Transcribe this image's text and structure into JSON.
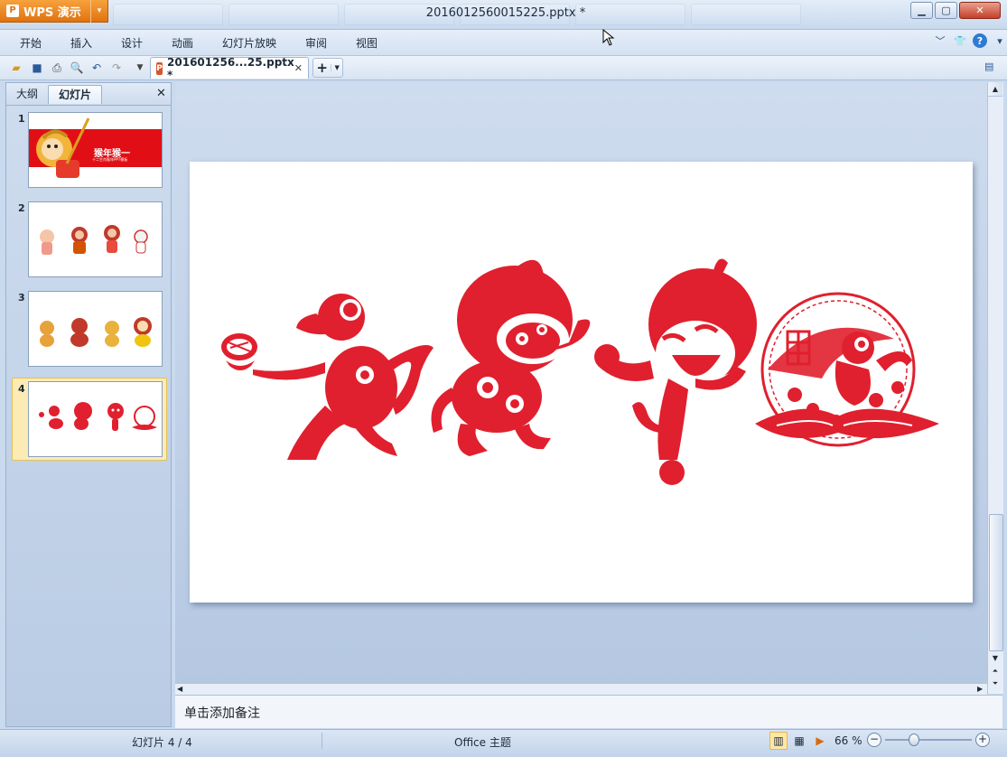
{
  "app": {
    "name": "WPS 演示",
    "document_title": "2016012560015225.pptx *"
  },
  "menu": [
    "开始",
    "插入",
    "设计",
    "动画",
    "幻灯片放映",
    "审阅",
    "视图"
  ],
  "toolbar": {
    "doc_tab_label": "201601256...25.pptx *"
  },
  "left_pane": {
    "tabs": [
      "大纲",
      "幻灯片"
    ],
    "slides": [
      {
        "number": "1",
        "title_text": "猴年猴一",
        "subtitle_text": "十二生肖猴年PPT模板"
      },
      {
        "number": "2"
      },
      {
        "number": "3"
      },
      {
        "number": "4",
        "selected": true
      }
    ]
  },
  "notes": {
    "placeholder": "单击添加备注"
  },
  "status": {
    "slide_indicator": "幻灯片 4 / 4",
    "theme": "Office 主题",
    "zoom": "66 %",
    "zoom_level_percent": 66
  },
  "colors": {
    "papercut_red": "#e0202e",
    "accent_orange": "#e0730f"
  }
}
